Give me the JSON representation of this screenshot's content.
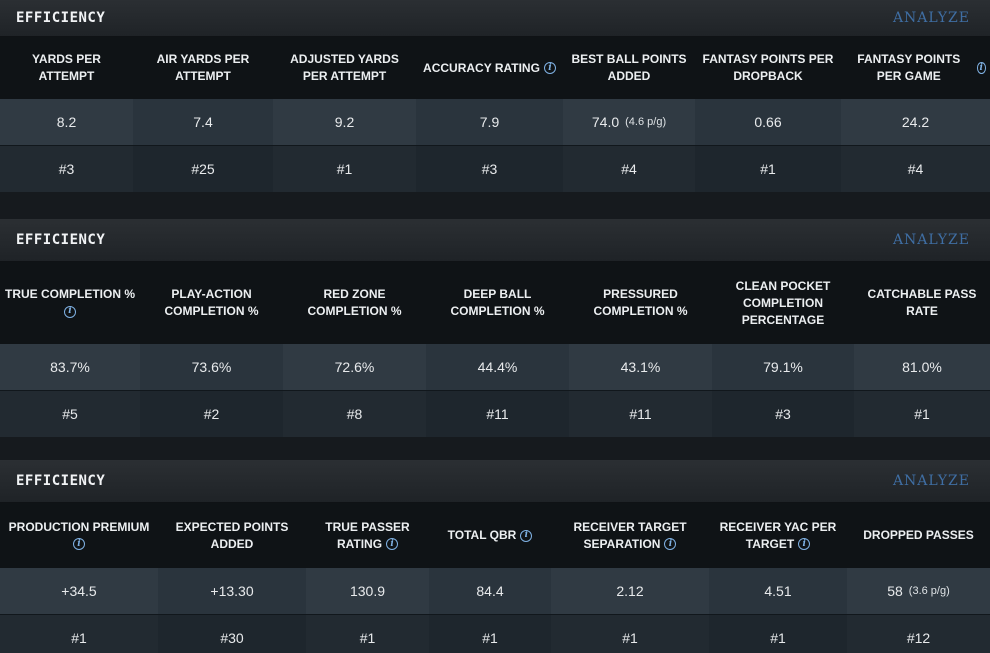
{
  "panels": [
    {
      "title": "EFFICIENCY",
      "action": "ANALYZE",
      "columns": [
        {
          "header": "YARDS PER ATTEMPT",
          "value": "8.2",
          "rank": "#3"
        },
        {
          "header": "AIR YARDS PER ATTEMPT",
          "value": "7.4",
          "rank": "#25"
        },
        {
          "header": "ADJUSTED YARDS PER ATTEMPT",
          "value": "9.2",
          "rank": "#1"
        },
        {
          "header": "ACCURACY RATING",
          "value": "7.9",
          "rank": "#3",
          "info": "i"
        },
        {
          "header": "BEST BALL POINTS ADDED",
          "value": "74.0",
          "per_game": "(4.6 p/g)",
          "rank": "#4"
        },
        {
          "header": "FANTASY POINTS PER DROPBACK",
          "value": "0.66",
          "rank": "#1"
        },
        {
          "header": "FANTASY POINTS PER GAME",
          "value": "24.2",
          "rank": "#4",
          "info": "i"
        }
      ]
    },
    {
      "title": "EFFICIENCY",
      "action": "ANALYZE",
      "columns": [
        {
          "header": "TRUE COMPLETION %",
          "value": "83.7%",
          "rank": "#5",
          "info": "i"
        },
        {
          "header": "PLAY-ACTION COMPLETION %",
          "value": "73.6%",
          "rank": "#2"
        },
        {
          "header": "RED ZONE COMPLETION %",
          "value": "72.6%",
          "rank": "#8"
        },
        {
          "header": "DEEP BALL COMPLETION %",
          "value": "44.4%",
          "rank": "#11"
        },
        {
          "header": "PRESSURED COMPLETION %",
          "value": "43.1%",
          "rank": "#11"
        },
        {
          "header": "CLEAN POCKET COMPLETION PERCENTAGE",
          "value": "79.1%",
          "rank": "#3"
        },
        {
          "header": "CATCHABLE PASS RATE",
          "value": "81.0%",
          "rank": "#1"
        }
      ]
    },
    {
      "title": "EFFICIENCY",
      "action": "ANALYZE",
      "columns": [
        {
          "header": "PRODUCTION PREMIUM",
          "value": "+34.5",
          "rank": "#1",
          "info": "i"
        },
        {
          "header": "EXPECTED POINTS ADDED",
          "value": "+13.30",
          "rank": "#30"
        },
        {
          "header": "TRUE PASSER RATING",
          "value": "130.9",
          "rank": "#1",
          "info": "i"
        },
        {
          "header": "TOTAL QBR",
          "value": "84.4",
          "rank": "#1",
          "info": "i"
        },
        {
          "header": "RECEIVER TARGET SEPARATION",
          "value": "2.12",
          "rank": "#1",
          "info": "i"
        },
        {
          "header": "RECEIVER YAC PER TARGET",
          "value": "4.51",
          "rank": "#1",
          "info": "i"
        },
        {
          "header": "DROPPED PASSES",
          "value": "58",
          "per_game": "(3.6 p/g)",
          "rank": "#12"
        }
      ]
    }
  ]
}
